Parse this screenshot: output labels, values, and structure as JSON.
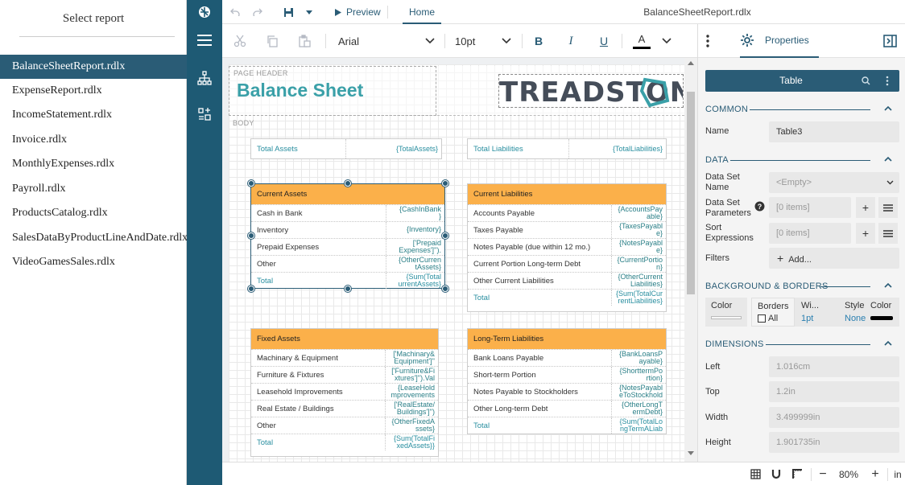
{
  "report_list": {
    "title": "Select report",
    "items": [
      {
        "label": "BalanceSheetReport.rdlx",
        "selected": true
      },
      {
        "label": "ExpenseReport.rdlx"
      },
      {
        "label": "IncomeStatement.rdlx"
      },
      {
        "label": "Invoice.rdlx"
      },
      {
        "label": "MonthlyExpenses.rdlx"
      },
      {
        "label": "Payroll.rdlx"
      },
      {
        "label": "ProductsCatalog.rdlx"
      },
      {
        "label": "SalesDataByProductLineAndDate.rdlx"
      },
      {
        "label": "VideoGamesSales.rdlx"
      }
    ]
  },
  "toolbar": {
    "preview_label": "Preview",
    "home_tab": "Home",
    "file_name": "BalanceSheetReport.rdlx"
  },
  "format": {
    "font": "Arial",
    "size": "10pt",
    "bold": "B",
    "italic": "I",
    "underline": "U",
    "font_color_letter": "A"
  },
  "canvas": {
    "page_header_label": "PAGE HEADER",
    "body_label": "BODY",
    "report_heading": "Balance Sheet",
    "logo_text": "TREADSTONE",
    "total_assets": {
      "label": "Total Assets",
      "expr": "{TotalAssets}"
    },
    "total_liabilities": {
      "label": "Total Liabilities",
      "expr": "{TotalLiabilities}"
    },
    "current_assets": {
      "header": "Current Assets",
      "rows": [
        {
          "label": "Cash in Bank",
          "expr": "{CashInBank\n}"
        },
        {
          "label": "Inventory",
          "expr": "{Inventory}"
        },
        {
          "label": "Prepaid Expenses",
          "expr": "['Prepaid\nExpenses']'')."
        },
        {
          "label": "Other",
          "expr": "{OtherCurren\ntAssets}"
        },
        {
          "label": "Total",
          "expr": "{Sum(Total\nurrentAssets}"
        }
      ]
    },
    "current_liabilities": {
      "header": "Current Liabilities",
      "rows": [
        {
          "label": "Accounts Payable",
          "expr": "{AccountsPay\nable}"
        },
        {
          "label": "Taxes Payable",
          "expr": "{TaxesPayabl\ne}"
        },
        {
          "label": "Notes Payable (due within 12 mo.)",
          "expr": "{NotesPayabl\ne}"
        },
        {
          "label": "Current Portion Long-term Debt",
          "expr": "{CurrentPortio\nn}"
        },
        {
          "label": "Other Current Liabilities",
          "expr": "{OtherCurrent\nLiabilities}"
        },
        {
          "label": "Total",
          "expr": "{Sum(TotalCur\nrentLiabilities}"
        }
      ]
    },
    "fixed_assets": {
      "header": "Fixed Assets",
      "rows": [
        {
          "label": "Machinary & Equipment",
          "expr": "['Machinary&\nEquipment']''"
        },
        {
          "label": "Furniture & Fixtures",
          "expr": "['Furniture&Fi\nxtures']'').Val"
        },
        {
          "label": "Leasehold Improvements",
          "expr": "{LeaseHold\nmprovements"
        },
        {
          "label": "Real Estate / Buildings",
          "expr": "['RealEstate/\nBuildings']'')"
        },
        {
          "label": "Other",
          "expr": "{OtherFixedA\nssets}"
        },
        {
          "label": "Total",
          "expr": "{Sum(TotalFi\nxedAssets}}"
        }
      ]
    },
    "long_term_liabilities": {
      "header": "Long-Term Liabilities",
      "rows": [
        {
          "label": "Bank Loans Payable",
          "expr": "{BankLoansP\nayable}"
        },
        {
          "label": "Short-term Portion",
          "expr": "{ShorttermPo\nrtion}"
        },
        {
          "label": "Notes Payable to Stockholders",
          "expr": "{NotesPayabl\neToStockhold"
        },
        {
          "label": "Other Long-term Debt",
          "expr": "{OtherLongT\nermDebt}"
        },
        {
          "label": "Total",
          "expr": "{Sum(TotalLo\nngTermALiab"
        }
      ]
    }
  },
  "properties": {
    "tab_label": "Properties",
    "object_type": "Table",
    "common": {
      "title": "COMMON",
      "name_label": "Name",
      "name_value": "Table3"
    },
    "data": {
      "title": "DATA",
      "dataset_name_label_1": "Data Set",
      "dataset_name_label_2": "Name",
      "dataset_name_value": "<Empty>",
      "dataset_params_label_1": "Data Set",
      "dataset_params_label_2": "Parameters",
      "dataset_params_value": "[0 items]",
      "sort_label_1": "Sort",
      "sort_label_2": "Expressions",
      "sort_value": "[0 items]",
      "filters_label": "Filters",
      "filters_add": "Add..."
    },
    "background": {
      "title": "BACKGROUND & BORDERS",
      "color_label": "Color",
      "borders_label": "Borders",
      "all_label": "All",
      "width_label": "Wi...",
      "width_value": "1pt",
      "style_label": "Style",
      "style_value": "None",
      "border_color_label": "Color"
    },
    "dimensions": {
      "title": "DIMENSIONS",
      "left_label": "Left",
      "left_value": "1.016cm",
      "top_label": "Top",
      "top_value": "1.2in",
      "width_label": "Width",
      "width_value": "3.499999in",
      "height_label": "Height",
      "height_value": "1.901735in"
    }
  },
  "status": {
    "zoom": "80%",
    "unit": "in"
  },
  "colors": {
    "accent": "#2a5c76",
    "nav_rail": "#1e5a74",
    "table_header": "#fbb04a",
    "heading_teal": "#3aa0a8"
  }
}
